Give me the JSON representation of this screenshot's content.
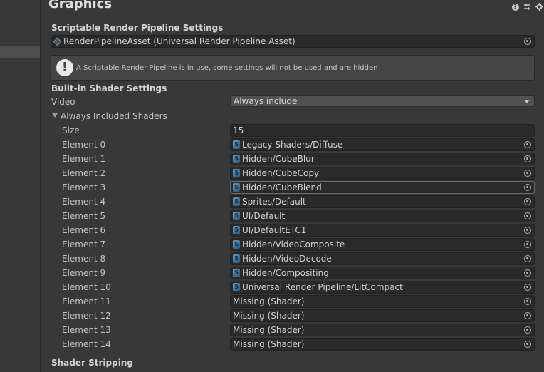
{
  "title": "Graphics",
  "title_icons": [
    "help-icon",
    "preset-icon",
    "settings-icon"
  ],
  "srp": {
    "header": "Scriptable Render Pipeline Settings",
    "asset_value": "RenderPipelineAsset (Universal Render Pipeline Asset)",
    "help_message": "A Scriptable Render Pipeline is in use, some settings will not be used and are hidden",
    "help_icon": "!"
  },
  "builtin": {
    "header": "Built-in Shader Settings",
    "video_label": "Video",
    "video_value": "Always include",
    "always_included_label": "Always Included Shaders",
    "size_label": "Size",
    "size_value": "15",
    "shader_icon_glyph": "S",
    "elements": [
      {
        "label": "Element 0",
        "value": "Legacy Shaders/Diffuse",
        "icon": true
      },
      {
        "label": "Element 1",
        "value": "Hidden/CubeBlur",
        "icon": true
      },
      {
        "label": "Element 2",
        "value": "Hidden/CubeCopy",
        "icon": true
      },
      {
        "label": "Element 3",
        "value": "Hidden/CubeBlend",
        "icon": true,
        "highlight": true
      },
      {
        "label": "Element 4",
        "value": "Sprites/Default",
        "icon": true
      },
      {
        "label": "Element 5",
        "value": "UI/Default",
        "icon": true
      },
      {
        "label": "Element 6",
        "value": "UI/DefaultETC1",
        "icon": true
      },
      {
        "label": "Element 7",
        "value": "Hidden/VideoComposite",
        "icon": true
      },
      {
        "label": "Element 8",
        "value": "Hidden/VideoDecode",
        "icon": true
      },
      {
        "label": "Element 9",
        "value": "Hidden/Compositing",
        "icon": true
      },
      {
        "label": "Element 10",
        "value": "Universal Render Pipeline/LitCompact",
        "icon": true
      },
      {
        "label": "Element 11",
        "value": "Missing (Shader)",
        "icon": false
      },
      {
        "label": "Element 12",
        "value": "Missing (Shader)",
        "icon": false
      },
      {
        "label": "Element 13",
        "value": "Missing (Shader)",
        "icon": false
      },
      {
        "label": "Element 14",
        "value": "Missing (Shader)",
        "icon": false
      }
    ]
  },
  "stripping": {
    "header": "Shader Stripping"
  }
}
